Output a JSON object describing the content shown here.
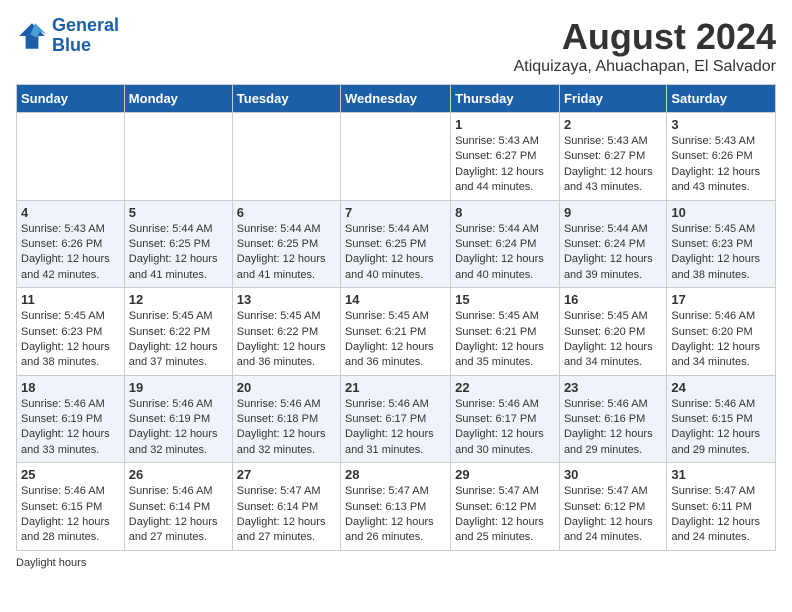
{
  "logo": {
    "line1": "General",
    "line2": "Blue"
  },
  "title": "August 2024",
  "subtitle": "Atiquizaya, Ahuachapan, El Salvador",
  "days_of_week": [
    "Sunday",
    "Monday",
    "Tuesday",
    "Wednesday",
    "Thursday",
    "Friday",
    "Saturday"
  ],
  "weeks": [
    [
      {
        "day": "",
        "sunrise": "",
        "sunset": "",
        "daylight": ""
      },
      {
        "day": "",
        "sunrise": "",
        "sunset": "",
        "daylight": ""
      },
      {
        "day": "",
        "sunrise": "",
        "sunset": "",
        "daylight": ""
      },
      {
        "day": "",
        "sunrise": "",
        "sunset": "",
        "daylight": ""
      },
      {
        "day": "1",
        "sunrise": "Sunrise: 5:43 AM",
        "sunset": "Sunset: 6:27 PM",
        "daylight": "Daylight: 12 hours and 44 minutes."
      },
      {
        "day": "2",
        "sunrise": "Sunrise: 5:43 AM",
        "sunset": "Sunset: 6:27 PM",
        "daylight": "Daylight: 12 hours and 43 minutes."
      },
      {
        "day": "3",
        "sunrise": "Sunrise: 5:43 AM",
        "sunset": "Sunset: 6:26 PM",
        "daylight": "Daylight: 12 hours and 43 minutes."
      }
    ],
    [
      {
        "day": "4",
        "sunrise": "Sunrise: 5:43 AM",
        "sunset": "Sunset: 6:26 PM",
        "daylight": "Daylight: 12 hours and 42 minutes."
      },
      {
        "day": "5",
        "sunrise": "Sunrise: 5:44 AM",
        "sunset": "Sunset: 6:25 PM",
        "daylight": "Daylight: 12 hours and 41 minutes."
      },
      {
        "day": "6",
        "sunrise": "Sunrise: 5:44 AM",
        "sunset": "Sunset: 6:25 PM",
        "daylight": "Daylight: 12 hours and 41 minutes."
      },
      {
        "day": "7",
        "sunrise": "Sunrise: 5:44 AM",
        "sunset": "Sunset: 6:25 PM",
        "daylight": "Daylight: 12 hours and 40 minutes."
      },
      {
        "day": "8",
        "sunrise": "Sunrise: 5:44 AM",
        "sunset": "Sunset: 6:24 PM",
        "daylight": "Daylight: 12 hours and 40 minutes."
      },
      {
        "day": "9",
        "sunrise": "Sunrise: 5:44 AM",
        "sunset": "Sunset: 6:24 PM",
        "daylight": "Daylight: 12 hours and 39 minutes."
      },
      {
        "day": "10",
        "sunrise": "Sunrise: 5:45 AM",
        "sunset": "Sunset: 6:23 PM",
        "daylight": "Daylight: 12 hours and 38 minutes."
      }
    ],
    [
      {
        "day": "11",
        "sunrise": "Sunrise: 5:45 AM",
        "sunset": "Sunset: 6:23 PM",
        "daylight": "Daylight: 12 hours and 38 minutes."
      },
      {
        "day": "12",
        "sunrise": "Sunrise: 5:45 AM",
        "sunset": "Sunset: 6:22 PM",
        "daylight": "Daylight: 12 hours and 37 minutes."
      },
      {
        "day": "13",
        "sunrise": "Sunrise: 5:45 AM",
        "sunset": "Sunset: 6:22 PM",
        "daylight": "Daylight: 12 hours and 36 minutes."
      },
      {
        "day": "14",
        "sunrise": "Sunrise: 5:45 AM",
        "sunset": "Sunset: 6:21 PM",
        "daylight": "Daylight: 12 hours and 36 minutes."
      },
      {
        "day": "15",
        "sunrise": "Sunrise: 5:45 AM",
        "sunset": "Sunset: 6:21 PM",
        "daylight": "Daylight: 12 hours and 35 minutes."
      },
      {
        "day": "16",
        "sunrise": "Sunrise: 5:45 AM",
        "sunset": "Sunset: 6:20 PM",
        "daylight": "Daylight: 12 hours and 34 minutes."
      },
      {
        "day": "17",
        "sunrise": "Sunrise: 5:46 AM",
        "sunset": "Sunset: 6:20 PM",
        "daylight": "Daylight: 12 hours and 34 minutes."
      }
    ],
    [
      {
        "day": "18",
        "sunrise": "Sunrise: 5:46 AM",
        "sunset": "Sunset: 6:19 PM",
        "daylight": "Daylight: 12 hours and 33 minutes."
      },
      {
        "day": "19",
        "sunrise": "Sunrise: 5:46 AM",
        "sunset": "Sunset: 6:19 PM",
        "daylight": "Daylight: 12 hours and 32 minutes."
      },
      {
        "day": "20",
        "sunrise": "Sunrise: 5:46 AM",
        "sunset": "Sunset: 6:18 PM",
        "daylight": "Daylight: 12 hours and 32 minutes."
      },
      {
        "day": "21",
        "sunrise": "Sunrise: 5:46 AM",
        "sunset": "Sunset: 6:17 PM",
        "daylight": "Daylight: 12 hours and 31 minutes."
      },
      {
        "day": "22",
        "sunrise": "Sunrise: 5:46 AM",
        "sunset": "Sunset: 6:17 PM",
        "daylight": "Daylight: 12 hours and 30 minutes."
      },
      {
        "day": "23",
        "sunrise": "Sunrise: 5:46 AM",
        "sunset": "Sunset: 6:16 PM",
        "daylight": "Daylight: 12 hours and 29 minutes."
      },
      {
        "day": "24",
        "sunrise": "Sunrise: 5:46 AM",
        "sunset": "Sunset: 6:15 PM",
        "daylight": "Daylight: 12 hours and 29 minutes."
      }
    ],
    [
      {
        "day": "25",
        "sunrise": "Sunrise: 5:46 AM",
        "sunset": "Sunset: 6:15 PM",
        "daylight": "Daylight: 12 hours and 28 minutes."
      },
      {
        "day": "26",
        "sunrise": "Sunrise: 5:46 AM",
        "sunset": "Sunset: 6:14 PM",
        "daylight": "Daylight: 12 hours and 27 minutes."
      },
      {
        "day": "27",
        "sunrise": "Sunrise: 5:47 AM",
        "sunset": "Sunset: 6:14 PM",
        "daylight": "Daylight: 12 hours and 27 minutes."
      },
      {
        "day": "28",
        "sunrise": "Sunrise: 5:47 AM",
        "sunset": "Sunset: 6:13 PM",
        "daylight": "Daylight: 12 hours and 26 minutes."
      },
      {
        "day": "29",
        "sunrise": "Sunrise: 5:47 AM",
        "sunset": "Sunset: 6:12 PM",
        "daylight": "Daylight: 12 hours and 25 minutes."
      },
      {
        "day": "30",
        "sunrise": "Sunrise: 5:47 AM",
        "sunset": "Sunset: 6:12 PM",
        "daylight": "Daylight: 12 hours and 24 minutes."
      },
      {
        "day": "31",
        "sunrise": "Sunrise: 5:47 AM",
        "sunset": "Sunset: 6:11 PM",
        "daylight": "Daylight: 12 hours and 24 minutes."
      }
    ]
  ],
  "footer": "Daylight hours"
}
